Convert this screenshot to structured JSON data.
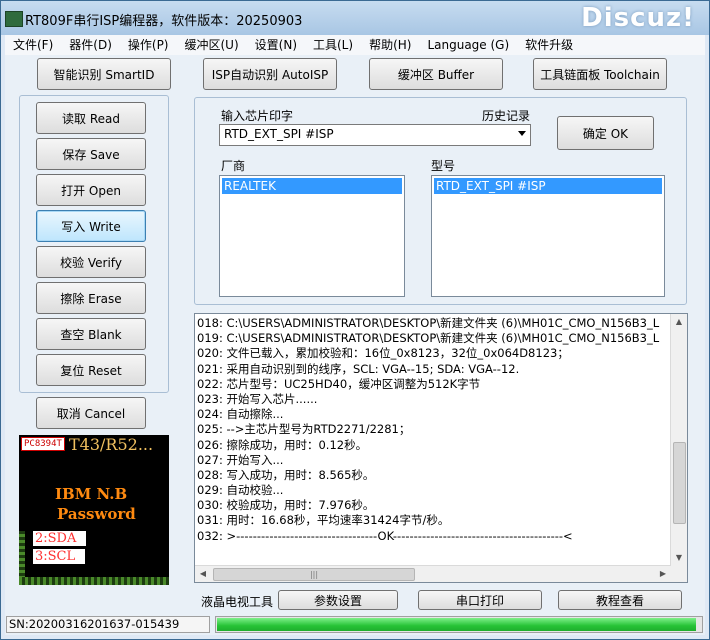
{
  "window": {
    "title": "RT809F串行ISP编程器，软件版本：20250903",
    "watermark": "Discuz!"
  },
  "menu": [
    "文件(F)",
    "器件(D)",
    "操作(P)",
    "缓冲区(U)",
    "设置(N)",
    "工具(L)",
    "帮助(H)",
    "Language (G)",
    "软件升级"
  ],
  "toolbar": {
    "smartid": "智能识别 SmartID",
    "autoisp": "ISP自动识别 AutoISP",
    "buffer": "缓冲区 Buffer",
    "toolchain": "工具链面板 Toolchain"
  },
  "actions": {
    "read": "读取 Read",
    "save": "保存 Save",
    "open": "打开 Open",
    "write": "写入 Write",
    "verify": "校验 Verify",
    "erase": "擦除 Erase",
    "blank": "查空 Blank",
    "reset": "复位 Reset",
    "cancel": "取消 Cancel"
  },
  "chip_panel": {
    "input_label": "输入芯片印字",
    "history_label": "历史记录",
    "input_value": "RTD_EXT_SPI #ISP",
    "ok_button": "确定 OK",
    "vendor_label": "厂商",
    "model_label": "型号",
    "vendor_selected": "REALTEK",
    "model_selected": "RTD_EXT_SPI #ISP"
  },
  "chip_image": {
    "tag": "PC8394T",
    "header": "T43/R52...",
    "line1": "IBM  N.B",
    "line2": "Password",
    "pin1": "2:SDA",
    "pin2": "3:SCL"
  },
  "log": [
    "018:  C:\\USERS\\ADMINISTRATOR\\DESKTOP\\新建文件夹 (6)\\MH01C_CMO_N156B3_L",
    "019:  C:\\USERS\\ADMINISTRATOR\\DESKTOP\\新建文件夹 (6)\\MH01C_CMO_N156B3_L",
    "020:  文件已载入，累加校验和：16位_0x8123，32位_0x064D8123；",
    "021:  采用自动识别到的线序，SCL: VGA--15; SDA: VGA--12.",
    "022:  芯片型号：UC25HD40，缓冲区调整为512K字节",
    "023:  开始写入芯片......",
    "024:  自动擦除...",
    "025:  -->主芯片型号为RTD2271/2281；",
    "026:  擦除成功，用时：0.12秒。",
    "027:  开始写入...",
    "028:  写入成功，用时：8.565秒。",
    "029:  自动校验...",
    "030:  校验成功，用时：7.976秒。",
    "031:  用时：16.68秒，平均速率31424字节/秒。",
    "032:  >----------------------------------OK-----------------------------------------<"
  ],
  "bottom_bar": {
    "label": "液晶电视工具",
    "params": "参数设置",
    "serial_print": "串口打印",
    "tutorial": "教程查看"
  },
  "status": {
    "sn": "SN:20200316201637-015439",
    "progress_fraction": 0.99
  },
  "colors": {
    "selection": "#3399ff",
    "progress": "#26c236",
    "chip_text": "#ff8a10"
  }
}
